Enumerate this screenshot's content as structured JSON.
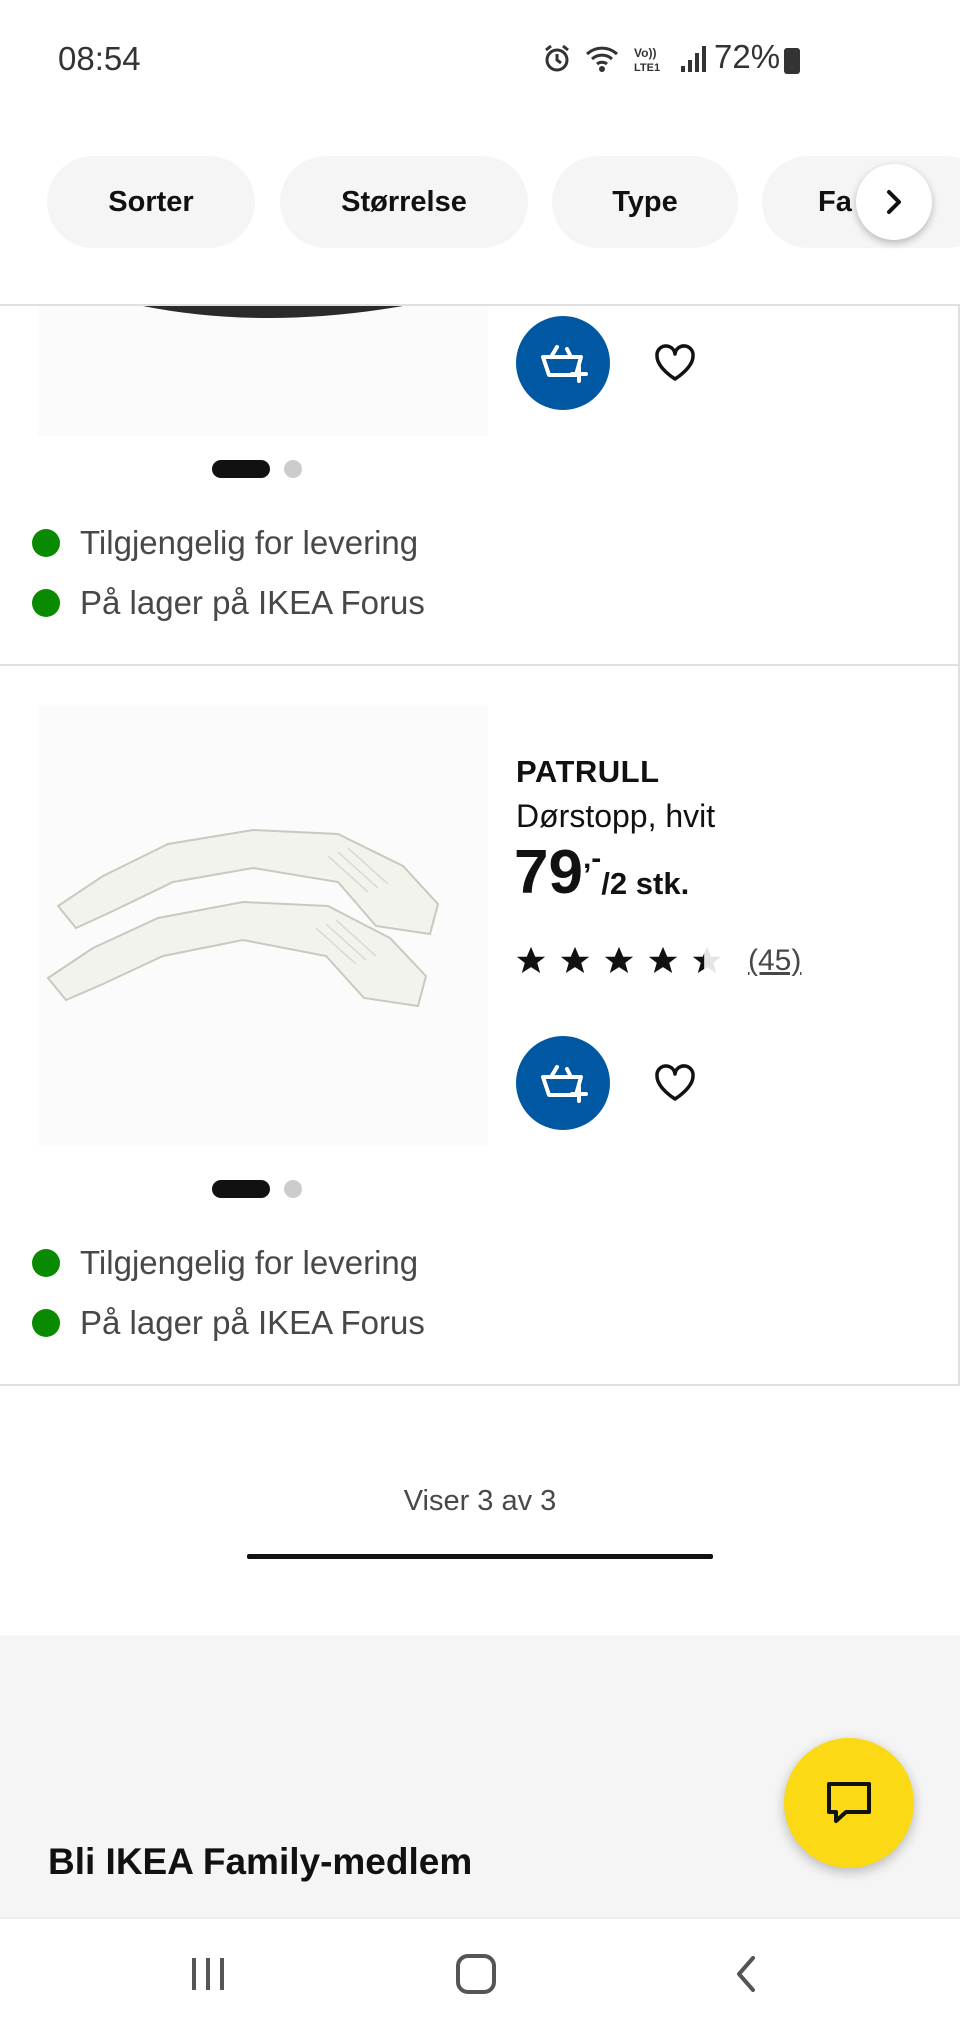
{
  "status_bar": {
    "time": "08:54",
    "battery": "72%",
    "icons": [
      "alarm-icon",
      "wifi-icon",
      "volte-icon",
      "signal-icon",
      "battery-icon"
    ]
  },
  "filters": {
    "chips": [
      "Sorter",
      "Størrelse",
      "Type",
      "Fa"
    ],
    "next_icon": "chevron-right-icon"
  },
  "product_1": {
    "availability": [
      "Tilgjengelig for levering",
      "På lager på IKEA Forus"
    ]
  },
  "product_2": {
    "name": "PATRULL",
    "description": "Dørstopp, hvit",
    "price_main": "79",
    "price_suffix": ",-",
    "price_unit": "/2 stk.",
    "rating_stars": 4.5,
    "rating_count": "(45)",
    "availability": [
      "Tilgjengelig for levering",
      "På lager på IKEA Forus"
    ]
  },
  "pagination": {
    "label": "Viser 3 av 3"
  },
  "footer": {
    "family_title": "Bli IKEA Family-medlem"
  },
  "colors": {
    "brand_blue": "#0058a3",
    "brand_yellow": "#fbd914",
    "in_stock_green": "#0a8a00"
  }
}
